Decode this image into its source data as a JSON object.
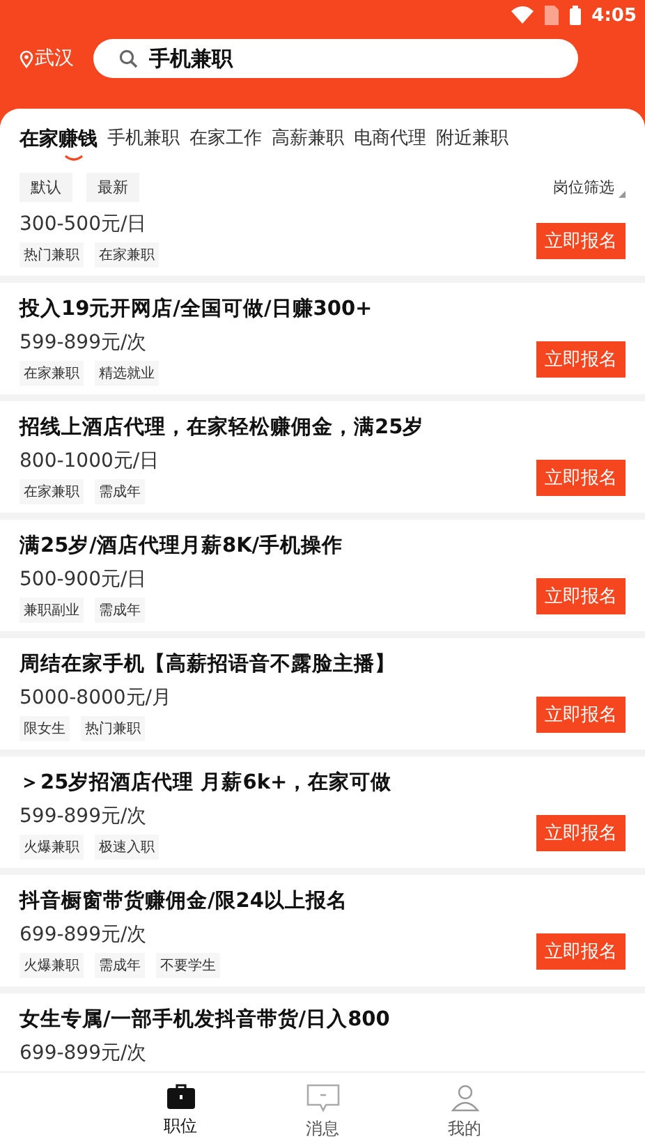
{
  "status_bar": {
    "time": "4:05"
  },
  "header": {
    "city": "武汉",
    "search": {
      "value": "手机兼职"
    }
  },
  "tabs": [
    {
      "label": "在家赚钱",
      "selected": true
    },
    {
      "label": "手机兼职",
      "selected": false
    },
    {
      "label": "在家工作",
      "selected": false
    },
    {
      "label": "高薪兼职",
      "selected": false
    },
    {
      "label": "电商代理",
      "selected": false
    },
    {
      "label": "附近兼职",
      "selected": false
    }
  ],
  "sort": {
    "options": [
      "默认",
      "最新"
    ],
    "filter": "岗位筛选"
  },
  "jobs": [
    {
      "price": "300-500元/日",
      "tags": [
        "热门兼职",
        "在家兼职"
      ],
      "button": "立即报名"
    },
    {
      "title": "投入19元开网店/全国可做/日赚300+",
      "price": "599-899元/次",
      "tags": [
        "在家兼职",
        "精选就业"
      ],
      "button": "立即报名"
    },
    {
      "title": "招线上酒店代理，在家轻松赚佣金，满25岁",
      "price": "800-1000元/日",
      "tags": [
        "在家兼职",
        "需成年"
      ],
      "button": "立即报名"
    },
    {
      "title": "满25岁/酒店代理月薪8K/手机操作",
      "price": "500-900元/日",
      "tags": [
        "兼职副业",
        "需成年"
      ],
      "button": "立即报名"
    },
    {
      "title": "周结在家手机【高薪招语音不露脸主播】",
      "price": "5000-8000元/月",
      "tags": [
        "限女生",
        "热门兼职"
      ],
      "button": "立即报名"
    },
    {
      "title": "＞25岁招酒店代理 月薪6k+，在家可做",
      "price": "599-899元/次",
      "tags": [
        "火爆兼职",
        "极速入职"
      ],
      "button": "立即报名"
    },
    {
      "title": "抖音橱窗带货赚佣金/限24以上报名",
      "price": "699-899元/次",
      "tags": [
        "火爆兼职",
        "需成年",
        "不要学生"
      ],
      "button": "立即报名"
    },
    {
      "title": "女生专属/一部手机发抖音带货/日入800",
      "price": "699-899元/次"
    }
  ],
  "bottom_nav": [
    {
      "label": "职位",
      "kind": "briefcase",
      "selected": true
    },
    {
      "label": "消息",
      "kind": "message",
      "selected": false
    },
    {
      "label": "我的",
      "kind": "person",
      "selected": false
    }
  ]
}
